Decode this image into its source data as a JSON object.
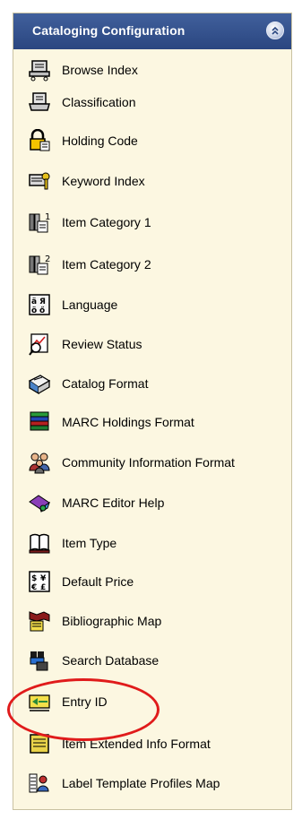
{
  "panel": {
    "title": "Cataloging Configuration",
    "collapse_icon": "double-chevron-up-icon",
    "colors": {
      "header": "#2f4e8c",
      "background": "#fcf7e1",
      "annotation": "#e01b1b"
    },
    "items": [
      {
        "label": "Browse Index",
        "icon": "browse-index-icon"
      },
      {
        "label": "Classification",
        "icon": "classification-icon"
      },
      {
        "label": "Holding Code",
        "icon": "holding-code-icon"
      },
      {
        "label": "Keyword Index",
        "icon": "keyword-index-icon"
      },
      {
        "label": "Item Category 1",
        "icon": "item-category-1-icon"
      },
      {
        "label": "Item Category 2",
        "icon": "item-category-2-icon"
      },
      {
        "label": "Language",
        "icon": "language-icon"
      },
      {
        "label": "Review Status",
        "icon": "review-status-icon"
      },
      {
        "label": "Catalog Format",
        "icon": "catalog-format-icon"
      },
      {
        "label": "MARC Holdings Format",
        "icon": "marc-holdings-format-icon"
      },
      {
        "label": "Community Information Format",
        "icon": "community-information-format-icon"
      },
      {
        "label": "MARC Editor Help",
        "icon": "marc-editor-help-icon"
      },
      {
        "label": "Item Type",
        "icon": "item-type-icon"
      },
      {
        "label": "Default Price",
        "icon": "default-price-icon"
      },
      {
        "label": "Bibliographic Map",
        "icon": "bibliographic-map-icon"
      },
      {
        "label": "Search Database",
        "icon": "search-database-icon"
      },
      {
        "label": "Entry ID",
        "icon": "entry-id-icon"
      },
      {
        "label": "Item Extended Info Format",
        "icon": "item-extended-info-format-icon"
      },
      {
        "label": "Label Template Profiles Map",
        "icon": "label-template-profiles-map-icon"
      }
    ]
  }
}
